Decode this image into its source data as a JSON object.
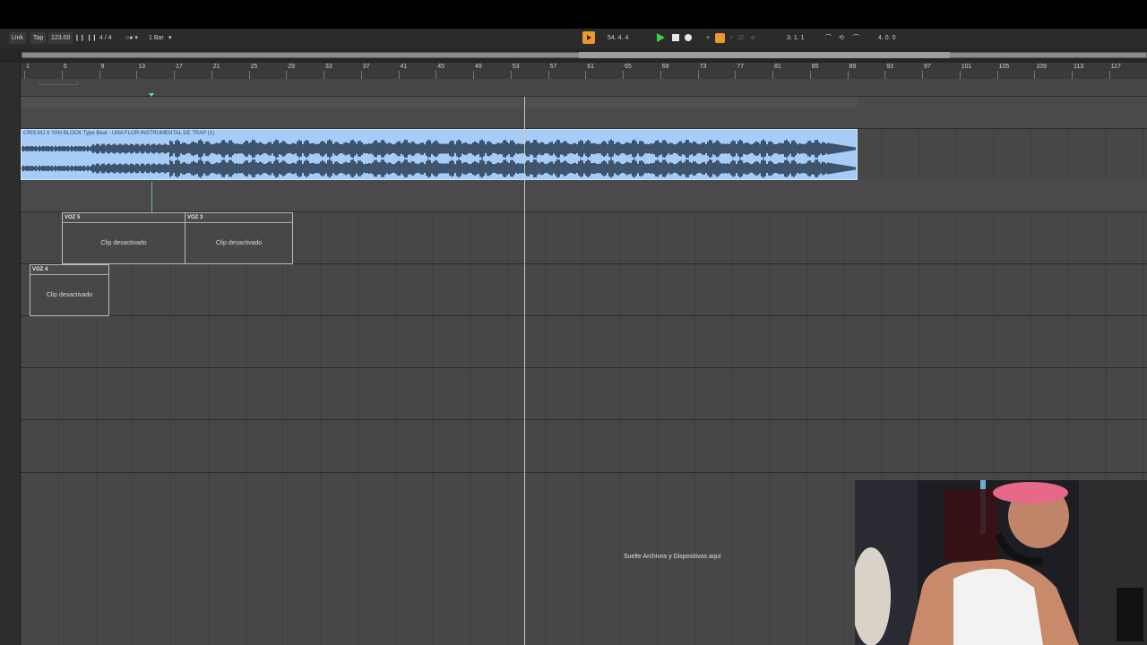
{
  "transport": {
    "link": "Link",
    "tap": "Tap",
    "tempo": "123.00",
    "signature": "4 / 4",
    "quantize": "1 Bar",
    "position": "54.  4.  4",
    "loop_start": "3.  1.  1",
    "loop_length": "4.  0.  0"
  },
  "ruler": {
    "labels": [
      "1",
      "5",
      "9",
      "13",
      "17",
      "21",
      "25",
      "29",
      "33",
      "37",
      "41",
      "45",
      "49",
      "53",
      "57",
      "61",
      "65",
      "69",
      "73",
      "77",
      "81",
      "85",
      "89",
      "93",
      "97",
      "101",
      "105",
      "109",
      "113",
      "117"
    ]
  },
  "clips": {
    "audio_title": "CRIS MJ X YAN BLOCK Type Beat - UNA FLOR  INSTRUMENTAL DE TRAP (1)",
    "voz5_name": "VOZ 5",
    "voz5_body": "Clip desactivado",
    "voz3_name": "VOZ 3",
    "voz3_body": "Clip desactivado",
    "voz4_name": "VOZ 4",
    "voz4_body": "Clip desactivado"
  },
  "drop_area": "Suelte Archivos y Dispositivos aquí",
  "colors": {
    "audio_clip": "#a6cdf7",
    "play_green": "#3fd14a",
    "accent_orange": "#e89a2e"
  }
}
